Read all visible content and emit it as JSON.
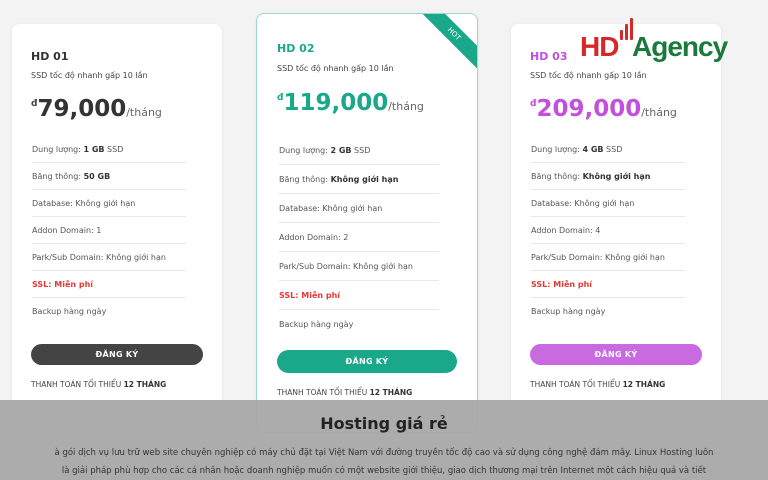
{
  "plans": [
    {
      "name": "HD 01",
      "subtitle": "SSD tốc độ nhanh gấp 10 lần",
      "currency": "đ",
      "price": "79,000",
      "unit": "/tháng",
      "features": {
        "storage": {
          "label": "Dung lượng: ",
          "value": "1 GB",
          "suffix": " SSD"
        },
        "bandwidth": {
          "label": "Băng thông: ",
          "value": "50 GB"
        },
        "database": "Database: Không giới hạn",
        "addon": "Addon Domain: 1",
        "park": "Park/Sub Domain: Không giới hạn",
        "ssl": "SSL: Miễn phí",
        "backup": "Backup hàng ngày"
      },
      "button": "ĐĂNG KÝ",
      "min_pay": {
        "label": "THANH TOÁN TỐI THIỂU ",
        "value": "12 THÁNG"
      }
    },
    {
      "name": "HD 02",
      "subtitle": "SSD tốc độ nhanh gấp 10 lần",
      "currency": "đ",
      "price": "119,000",
      "unit": "/tháng",
      "ribbon": "HOT",
      "features": {
        "storage": {
          "label": "Dung lượng: ",
          "value": "2 GB",
          "suffix": " SSD"
        },
        "bandwidth": {
          "label": "Băng thông: ",
          "value": "Không giới hạn"
        },
        "database": "Database: Không giới hạn",
        "addon": "Addon Domain: 2",
        "park": "Park/Sub Domain: Không giới hạn",
        "ssl": "SSL: Miễn phí",
        "backup": "Backup hàng ngày"
      },
      "button": "ĐĂNG KÝ",
      "min_pay": {
        "label": "THANH TOÁN TỐI THIỂU ",
        "value": "12 THÁNG"
      }
    },
    {
      "name": "HD 03",
      "subtitle": "SSD tốc độ nhanh gấp 10 lần",
      "currency": "đ",
      "price": "209,000",
      "unit": "/tháng",
      "features": {
        "storage": {
          "label": "Dung lượng: ",
          "value": "4 GB",
          "suffix": " SSD"
        },
        "bandwidth": {
          "label": "Băng thông: ",
          "value": "Không giới hạn"
        },
        "database": "Database: Không giới hạn",
        "addon": "Addon Domain: 4",
        "park": "Park/Sub Domain: Không giới hạn",
        "ssl": "SSL: Miễn phí",
        "backup": "Backup hàng ngày"
      },
      "button": "ĐĂNG KÝ",
      "min_pay": {
        "label": "THANH TOÁN TỐI THIỂU ",
        "value": "12 THÁNG"
      }
    }
  ],
  "logo": {
    "part1": "HD",
    "part2": "Agency",
    "icon": "signal-bars-icon"
  },
  "overlay": {
    "title": "Hosting giá rẻ",
    "line1": "à gói dịch vụ lưu trữ web site chuyên nghiệp có máy chủ đặt tại Việt Nam với đường truyền tốc độ cao và sử dụng công nghệ đám mây. Linux Hosting luôn",
    "line2": "là giải pháp phù hợp cho các cá nhân hoặc doanh nghiệp muốn có một website giới thiệu, giao dịch thương mại trên Internet một cách hiệu quả và tiết"
  },
  "colors": {
    "plan1": "#444444",
    "plan2": "#1aa88a",
    "plan3": "#c34fdc",
    "ssl": "#e53935"
  }
}
